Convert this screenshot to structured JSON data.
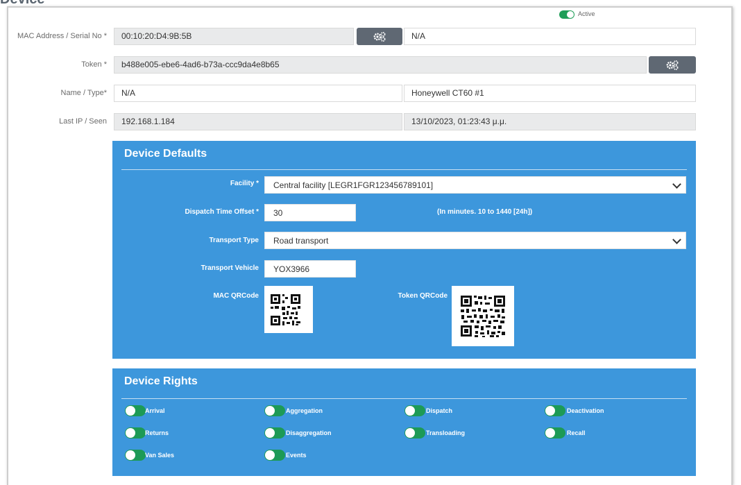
{
  "page": {
    "title": "Device"
  },
  "status": {
    "label": "Active",
    "on": true
  },
  "fields": {
    "mac": {
      "label": "MAC Address / Serial No *",
      "value": "00:10:20:D4:9B:5B",
      "serial": "N/A"
    },
    "token": {
      "label": "Token *",
      "value": "b488e005-ebe6-4ad6-b73a-ccc9da4e8b65"
    },
    "name": {
      "label": "Name / Type*",
      "name": "N/A",
      "type": "Honeywell CT60 #1"
    },
    "last": {
      "label": "Last IP / Seen",
      "ip": "192.168.1.184",
      "seen": "13/10/2023, 01:23:43 μ.μ."
    }
  },
  "defaults": {
    "title": "Device Defaults",
    "facility": {
      "label": "Facility *",
      "value": "Central facility [LEGR1FGR123456789101]"
    },
    "dispatch": {
      "label": "Dispatch Time Offset *",
      "value": "30",
      "hint": "(In minutes. 10 to 1440 [24h])"
    },
    "transport_type": {
      "label": "Transport Type",
      "value": "Road transport"
    },
    "vehicle": {
      "label": "Transport Vehicle",
      "value": "YOX3966"
    },
    "mac_qr": {
      "label": "MAC QRCode"
    },
    "token_qr": {
      "label": "Token QRCode"
    }
  },
  "rights": {
    "title": "Device Rights",
    "items": [
      {
        "label": "Arrival",
        "on": true
      },
      {
        "label": "Aggregation",
        "on": true
      },
      {
        "label": "Dispatch",
        "on": true
      },
      {
        "label": "Deactivation",
        "on": true
      },
      {
        "label": "Returns",
        "on": true
      },
      {
        "label": "Disaggregation",
        "on": true
      },
      {
        "label": "Transloading",
        "on": true
      },
      {
        "label": "Recall",
        "on": true
      },
      {
        "label": "Van Sales",
        "on": true
      },
      {
        "label": "Events",
        "on": true
      }
    ]
  },
  "colors": {
    "panel": "#3d97dc",
    "toggle_on": "#1f9e58",
    "button": "#5f6873"
  },
  "icons": {
    "generate": "gears-icon"
  }
}
